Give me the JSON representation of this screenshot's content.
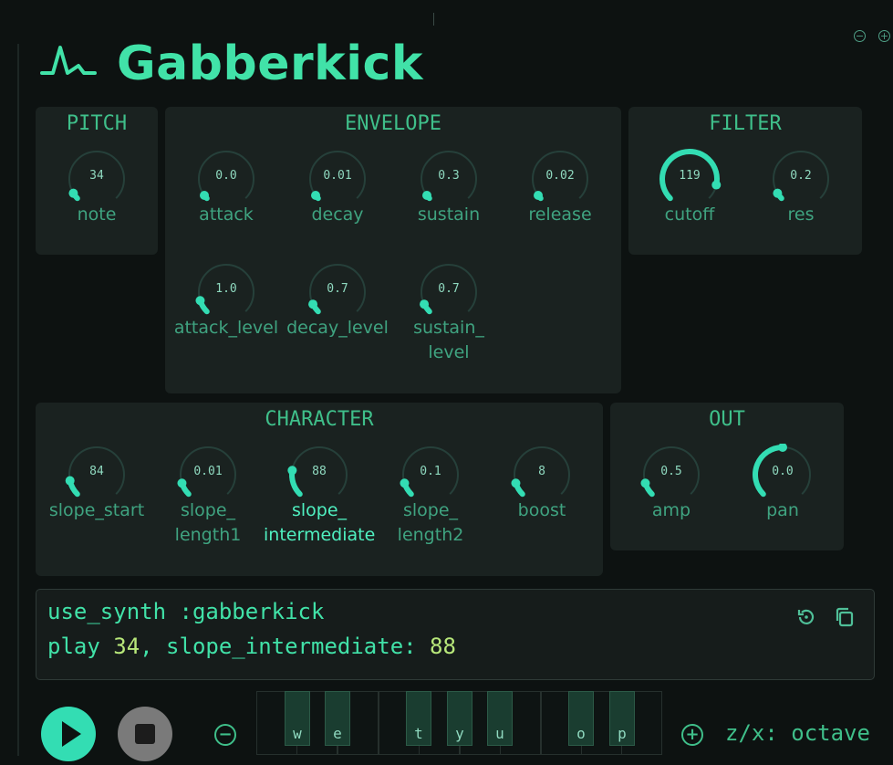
{
  "app": {
    "title": "Gabberkick",
    "icon": "waveform-pulse-icon"
  },
  "colors": {
    "accent": "#33ddb3",
    "title": "#41e2a8",
    "panel": "#1a2220",
    "number": "#b8e87a"
  },
  "panels": {
    "pitch": {
      "title": "PITCH",
      "knobs": [
        {
          "label": "note",
          "value": "34",
          "level": 0.05
        }
      ]
    },
    "envelope": {
      "title": "ENVELOPE",
      "knobs": [
        {
          "label": "attack",
          "value": "0.0",
          "level": 0.0
        },
        {
          "label": "decay",
          "value": "0.01",
          "level": 0.01
        },
        {
          "label": "sustain",
          "value": "0.3",
          "level": 0.02
        },
        {
          "label": "release",
          "value": "0.02",
          "level": 0.01
        },
        {
          "label": "attack_level",
          "value": "1.0",
          "level": 0.1
        },
        {
          "label": "decay_level",
          "value": "0.7",
          "level": 0.07
        },
        {
          "label": "sustain_\nlevel",
          "value": "0.7",
          "level": 0.07
        }
      ]
    },
    "filter": {
      "title": "FILTER",
      "knobs": [
        {
          "label": "cutoff",
          "value": "119",
          "level": 0.88
        },
        {
          "label": "res",
          "value": "0.2",
          "level": 0.05
        }
      ]
    },
    "character": {
      "title": "CHARACTER",
      "knobs": [
        {
          "label": "slope_start",
          "value": "84",
          "level": 0.12
        },
        {
          "label": "slope_\nlength1",
          "value": "0.01",
          "level": 0.1
        },
        {
          "label": "slope_\nintermediate",
          "value": "88",
          "level": 0.2
        },
        {
          "label": "slope_\nlength2",
          "value": "0.1",
          "level": 0.1
        },
        {
          "label": "boost",
          "value": "8",
          "level": 0.1
        }
      ]
    },
    "out": {
      "title": "OUT",
      "knobs": [
        {
          "label": "amp",
          "value": "0.5",
          "level": 0.1
        },
        {
          "label": "pan",
          "value": "0.0",
          "level": 0.5
        }
      ]
    }
  },
  "code": {
    "line1": "use_synth :gabberkick",
    "line2_prefix": "play ",
    "line2_note": "34",
    "line2_mid": ", slope_intermediate: ",
    "line2_value": "88",
    "reset_icon": "reset-icon",
    "copy_icon": "copy-icon"
  },
  "keyboard": {
    "keys": [
      "w",
      "e",
      "t",
      "y",
      "u",
      "o",
      "p"
    ],
    "octave_hint": "z/x: octave"
  }
}
